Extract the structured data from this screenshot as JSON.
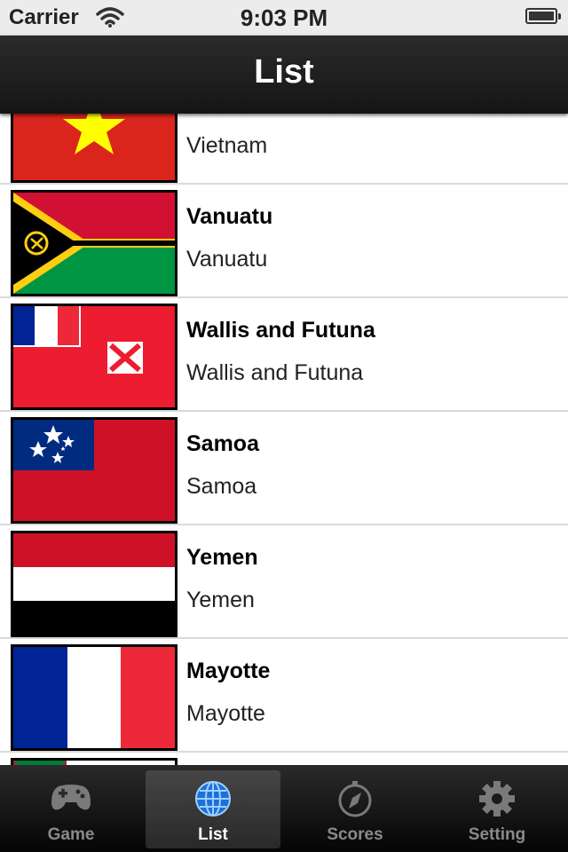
{
  "status": {
    "carrier": "Carrier",
    "time": "9:03 PM"
  },
  "header": {
    "title": "List"
  },
  "rows": [
    {
      "title": "",
      "subtitle": "Vietnam",
      "flag": "vietnam-flag"
    },
    {
      "title": "Vanuatu",
      "subtitle": "Vanuatu",
      "flag": "vanuatu-flag"
    },
    {
      "title": "Wallis and Futuna",
      "subtitle": "Wallis and Futuna",
      "flag": "wallis-futuna-flag"
    },
    {
      "title": "Samoa",
      "subtitle": "Samoa",
      "flag": "samoa-flag"
    },
    {
      "title": "Yemen",
      "subtitle": "Yemen",
      "flag": "yemen-flag"
    },
    {
      "title": "Mayotte",
      "subtitle": "Mayotte",
      "flag": "mayotte-flag"
    }
  ],
  "tabs": [
    {
      "label": "Game",
      "icon": "gamepad-icon"
    },
    {
      "label": "List",
      "icon": "globe-icon",
      "active": true
    },
    {
      "label": "Scores",
      "icon": "compass-icon"
    },
    {
      "label": "Setting",
      "icon": "gear-icon"
    }
  ]
}
